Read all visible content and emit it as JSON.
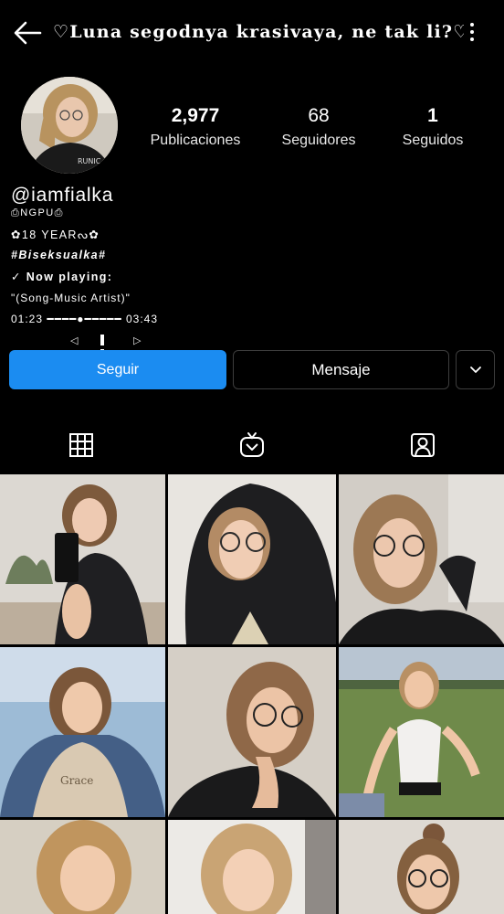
{
  "header": {
    "title": "♡Luna segodnya krasivaya, ne tak li?♡",
    "back_icon": "arrow-left-icon",
    "more_icon": "vertical-ellipsis-icon"
  },
  "profile": {
    "handle": "@iamfialka",
    "stats": [
      {
        "value": "2,977",
        "label": "Publicaciones"
      },
      {
        "value": "68",
        "label": "Seguidores"
      },
      {
        "value": "1",
        "label": "Seguidos"
      }
    ],
    "bio": [
      "⎙NGPU⎙",
      "✿18 YEARᔓ✿",
      "#Biseksualka#",
      "✓ Now playing:",
      "\"(Song-Music Artist)\"",
      "01:23 ━━━━●━━━━━ 03:43"
    ],
    "player": {
      "prev": "◁",
      "next": "▷"
    }
  },
  "actions": {
    "follow_label": "Seguir",
    "message_label": "Mensaje",
    "follow_color": "#1b8cf1"
  },
  "tabs": [
    {
      "icon": "grid-icon",
      "active": true
    },
    {
      "icon": "igtv-icon",
      "active": false
    },
    {
      "icon": "tagged-user-icon",
      "active": false
    }
  ],
  "posts": [
    {
      "icon": "photo-mirror-selfie"
    },
    {
      "icon": "photo-hoodie-glasses"
    },
    {
      "icon": "photo-hand-on-cheek"
    },
    {
      "icon": "photo-denim-jacket"
    },
    {
      "icon": "photo-glasses-closeup"
    },
    {
      "icon": "photo-field-outdoor"
    },
    {
      "icon": "photo-curly-hair"
    },
    {
      "icon": "photo-blonde-selfie"
    },
    {
      "icon": "photo-bun-glasses"
    }
  ]
}
